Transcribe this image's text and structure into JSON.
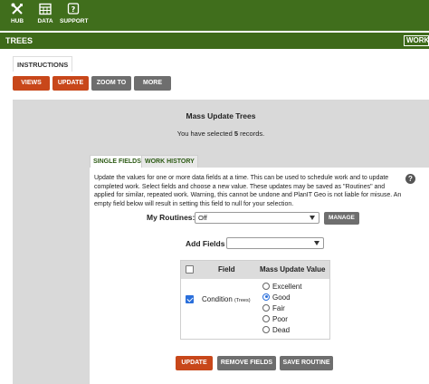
{
  "nav": {
    "items": [
      {
        "label": "HUB",
        "icon": "tools-icon"
      },
      {
        "label": "DATA",
        "icon": "table-icon"
      },
      {
        "label": "SUPPORT",
        "icon": "question-icon"
      }
    ]
  },
  "titlebar": {
    "title": "TREES",
    "work_tab": "WORK"
  },
  "instructions_tab": "INSTRUCTIONS",
  "actions": {
    "views": "VIEWS",
    "update": "UPDATE",
    "zoom_to": "ZOOM TO",
    "more": "MORE"
  },
  "panel": {
    "title": "Mass Update Trees",
    "subtitle_prefix": "You have selected",
    "record_count": "5",
    "subtitle_suffix": "records."
  },
  "tabs": {
    "single_fields": "SINGLE FIELDS",
    "work_history": "WORK HISTORY"
  },
  "instructions_text": "Update the values for one or more data fields at a time. This can be used to schedule work and to update completed work. Select fields and choose a new value. These updates may be saved as \"Routines\" and applied for similar, repeated work. Warning, this cannot be undone and PlanIT Geo is not liable for misuse. An empty field below will result in setting this field to null for your selection.",
  "help_icon": "?",
  "routines": {
    "label": "My Routines:",
    "value": "Off",
    "manage_label": "MANAGE"
  },
  "add_fields": {
    "label": "Add Fields",
    "value": ""
  },
  "table": {
    "headers": {
      "field": "Field",
      "value": "Mass Update Value"
    },
    "row": {
      "checked": true,
      "field_label": "Condition",
      "field_sub": "(Trees)",
      "options": [
        {
          "label": "Excellent",
          "selected": false
        },
        {
          "label": "Good",
          "selected": true
        },
        {
          "label": "Fair",
          "selected": false
        },
        {
          "label": "Poor",
          "selected": false
        },
        {
          "label": "Dead",
          "selected": false
        }
      ]
    }
  },
  "footer_buttons": {
    "update": "UPDATE",
    "remove_fields": "REMOVE FIELDS",
    "save_routine": "SAVE ROUTINE"
  },
  "colors": {
    "topbar": "#406e1c",
    "accent_orange": "#c8471a",
    "button_gray": "#6e6e6e",
    "panel_gray": "#d9d9d9",
    "tab_green": "#2c5a14",
    "check_blue": "#2a6fdb"
  }
}
